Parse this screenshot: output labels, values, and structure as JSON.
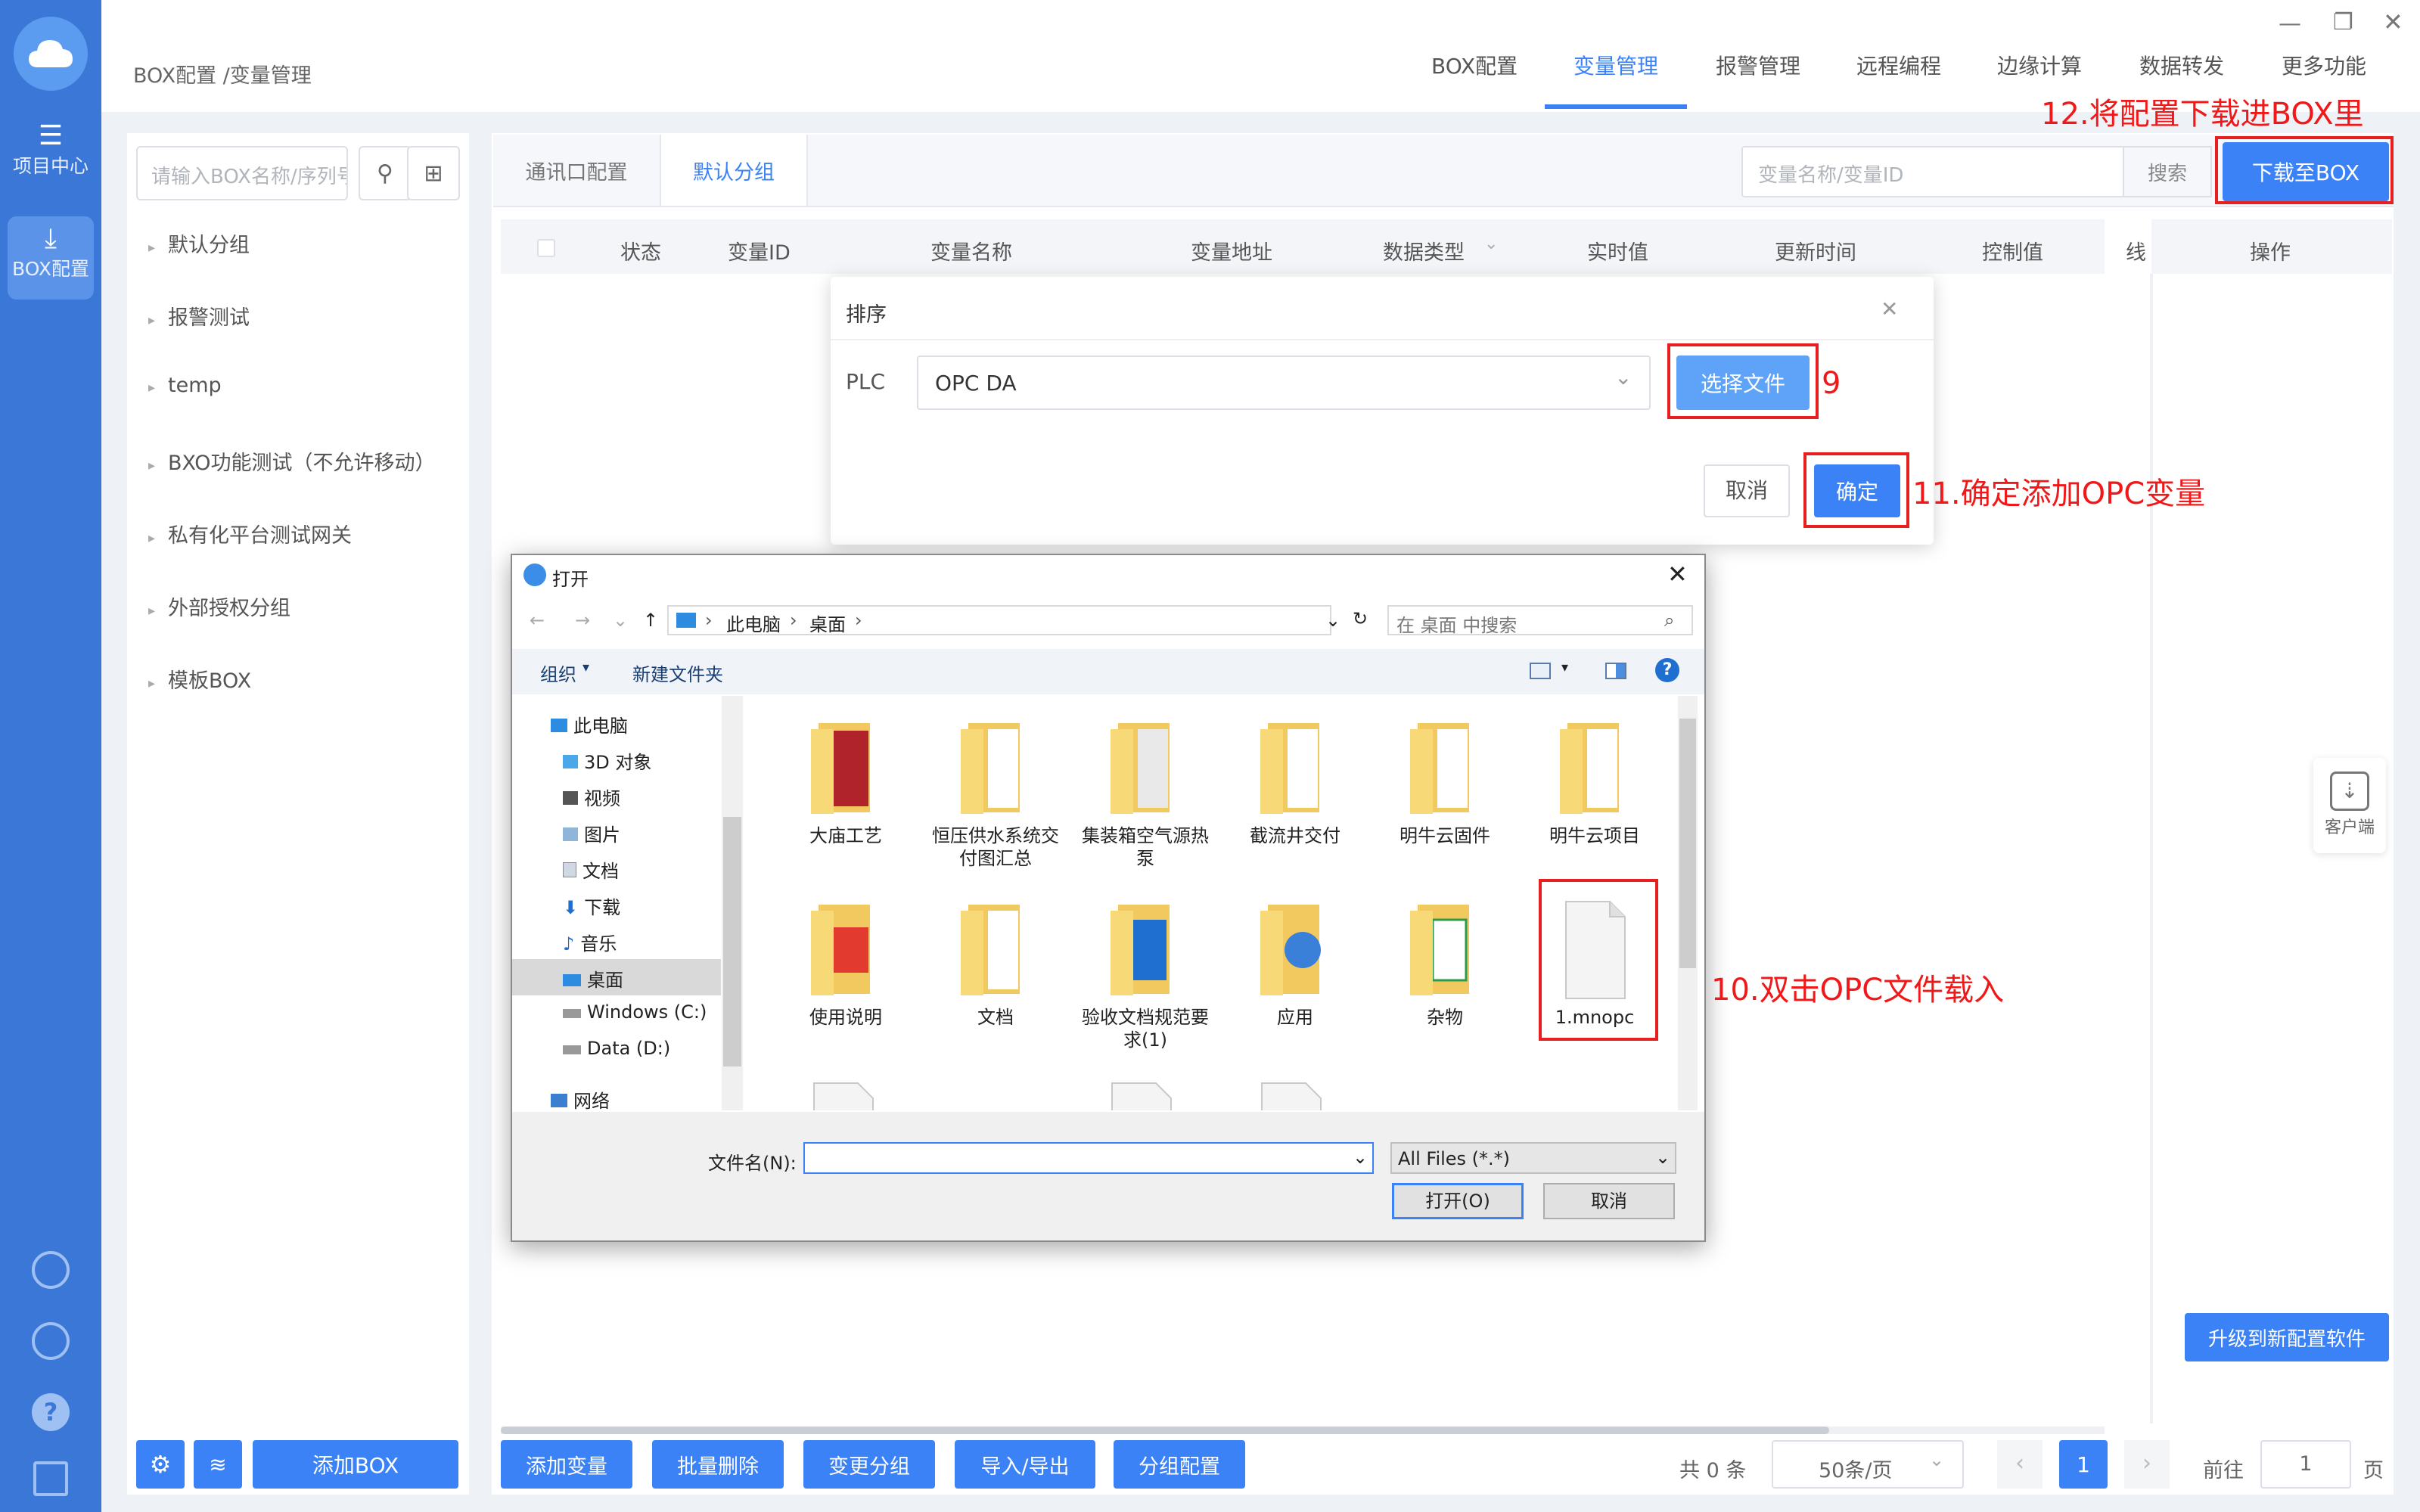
{
  "rail": {
    "items": [
      {
        "label": "项目中心"
      },
      {
        "label": "BOX配置"
      }
    ]
  },
  "header": {
    "breadcrumb": "BOX配置 /变量管理",
    "tabs": [
      "BOX配置",
      "变量管理",
      "报警管理",
      "远程编程",
      "边缘计算",
      "数据转发",
      "更多功能"
    ],
    "active_tab": "变量管理"
  },
  "annotations": {
    "step12": "12.将配置下载进BOX里",
    "step9": "9",
    "step11": "11.确定添加OPC变量",
    "step10": "10.双击OPC文件载入"
  },
  "sidebar": {
    "search_placeholder": "请输入BOX名称/序列号",
    "groups": [
      "默认分组",
      "报警测试",
      "temp",
      "BXO功能测试（不允许移动）",
      "私有化平台测试网关",
      "外部授权分组",
      "模板BOX"
    ],
    "add_box": "添加BOX"
  },
  "main": {
    "subtabs": [
      "通讯口配置",
      "默认分组"
    ],
    "search_placeholder": "变量名称/变量ID",
    "search_button": "搜索",
    "download_button": "下载至BOX",
    "columns": [
      "状态",
      "变量ID",
      "变量名称",
      "变量地址",
      "数据类型",
      "实时值",
      "更新时间",
      "控制值",
      "线",
      "操作"
    ],
    "client_label": "客户端",
    "upgrade_button": "升级到新配置软件",
    "actions": [
      "添加变量",
      "批量删除",
      "变更分组",
      "导入/导出",
      "分组配置"
    ],
    "pagination": {
      "total": "共 0 条",
      "page_size": "50条/页",
      "current_page": "1",
      "goto_label": "前往",
      "goto_value": "1",
      "page_suffix": "页"
    }
  },
  "modal": {
    "title": "排序",
    "plc_label": "PLC",
    "plc_value": "OPC DA",
    "choose_file": "选择文件",
    "cancel": "取消",
    "confirm": "确定"
  },
  "file_dialog": {
    "title": "打开",
    "path": [
      "此电脑",
      "桌面"
    ],
    "search_placeholder": "在 桌面 中搜索",
    "organize": "组织",
    "new_folder": "新建文件夹",
    "nav": [
      "此电脑",
      "3D 对象",
      "视频",
      "图片",
      "文档",
      "下载",
      "音乐",
      "桌面",
      "Windows (C:)",
      "Data (D:)",
      "网络"
    ],
    "files": [
      {
        "name": "大庙工艺",
        "type": "folder"
      },
      {
        "name": "恒压供水系统交付图汇总",
        "type": "folder"
      },
      {
        "name": "集装箱空气源热泵",
        "type": "folder"
      },
      {
        "name": "截流井交付",
        "type": "folder"
      },
      {
        "name": "明牛云固件",
        "type": "folder"
      },
      {
        "name": "明牛云项目",
        "type": "folder"
      },
      {
        "name": "使用说明",
        "type": "folder"
      },
      {
        "name": "文档",
        "type": "folder"
      },
      {
        "name": "验收文档规范要求(1)",
        "type": "folder"
      },
      {
        "name": "应用",
        "type": "folder"
      },
      {
        "name": "杂物",
        "type": "folder"
      },
      {
        "name": "1.mnopc",
        "type": "file"
      }
    ],
    "filename_label": "文件名(N):",
    "filter": "All Files (*.*)",
    "open_button": "打开(O)",
    "cancel_button": "取消"
  }
}
